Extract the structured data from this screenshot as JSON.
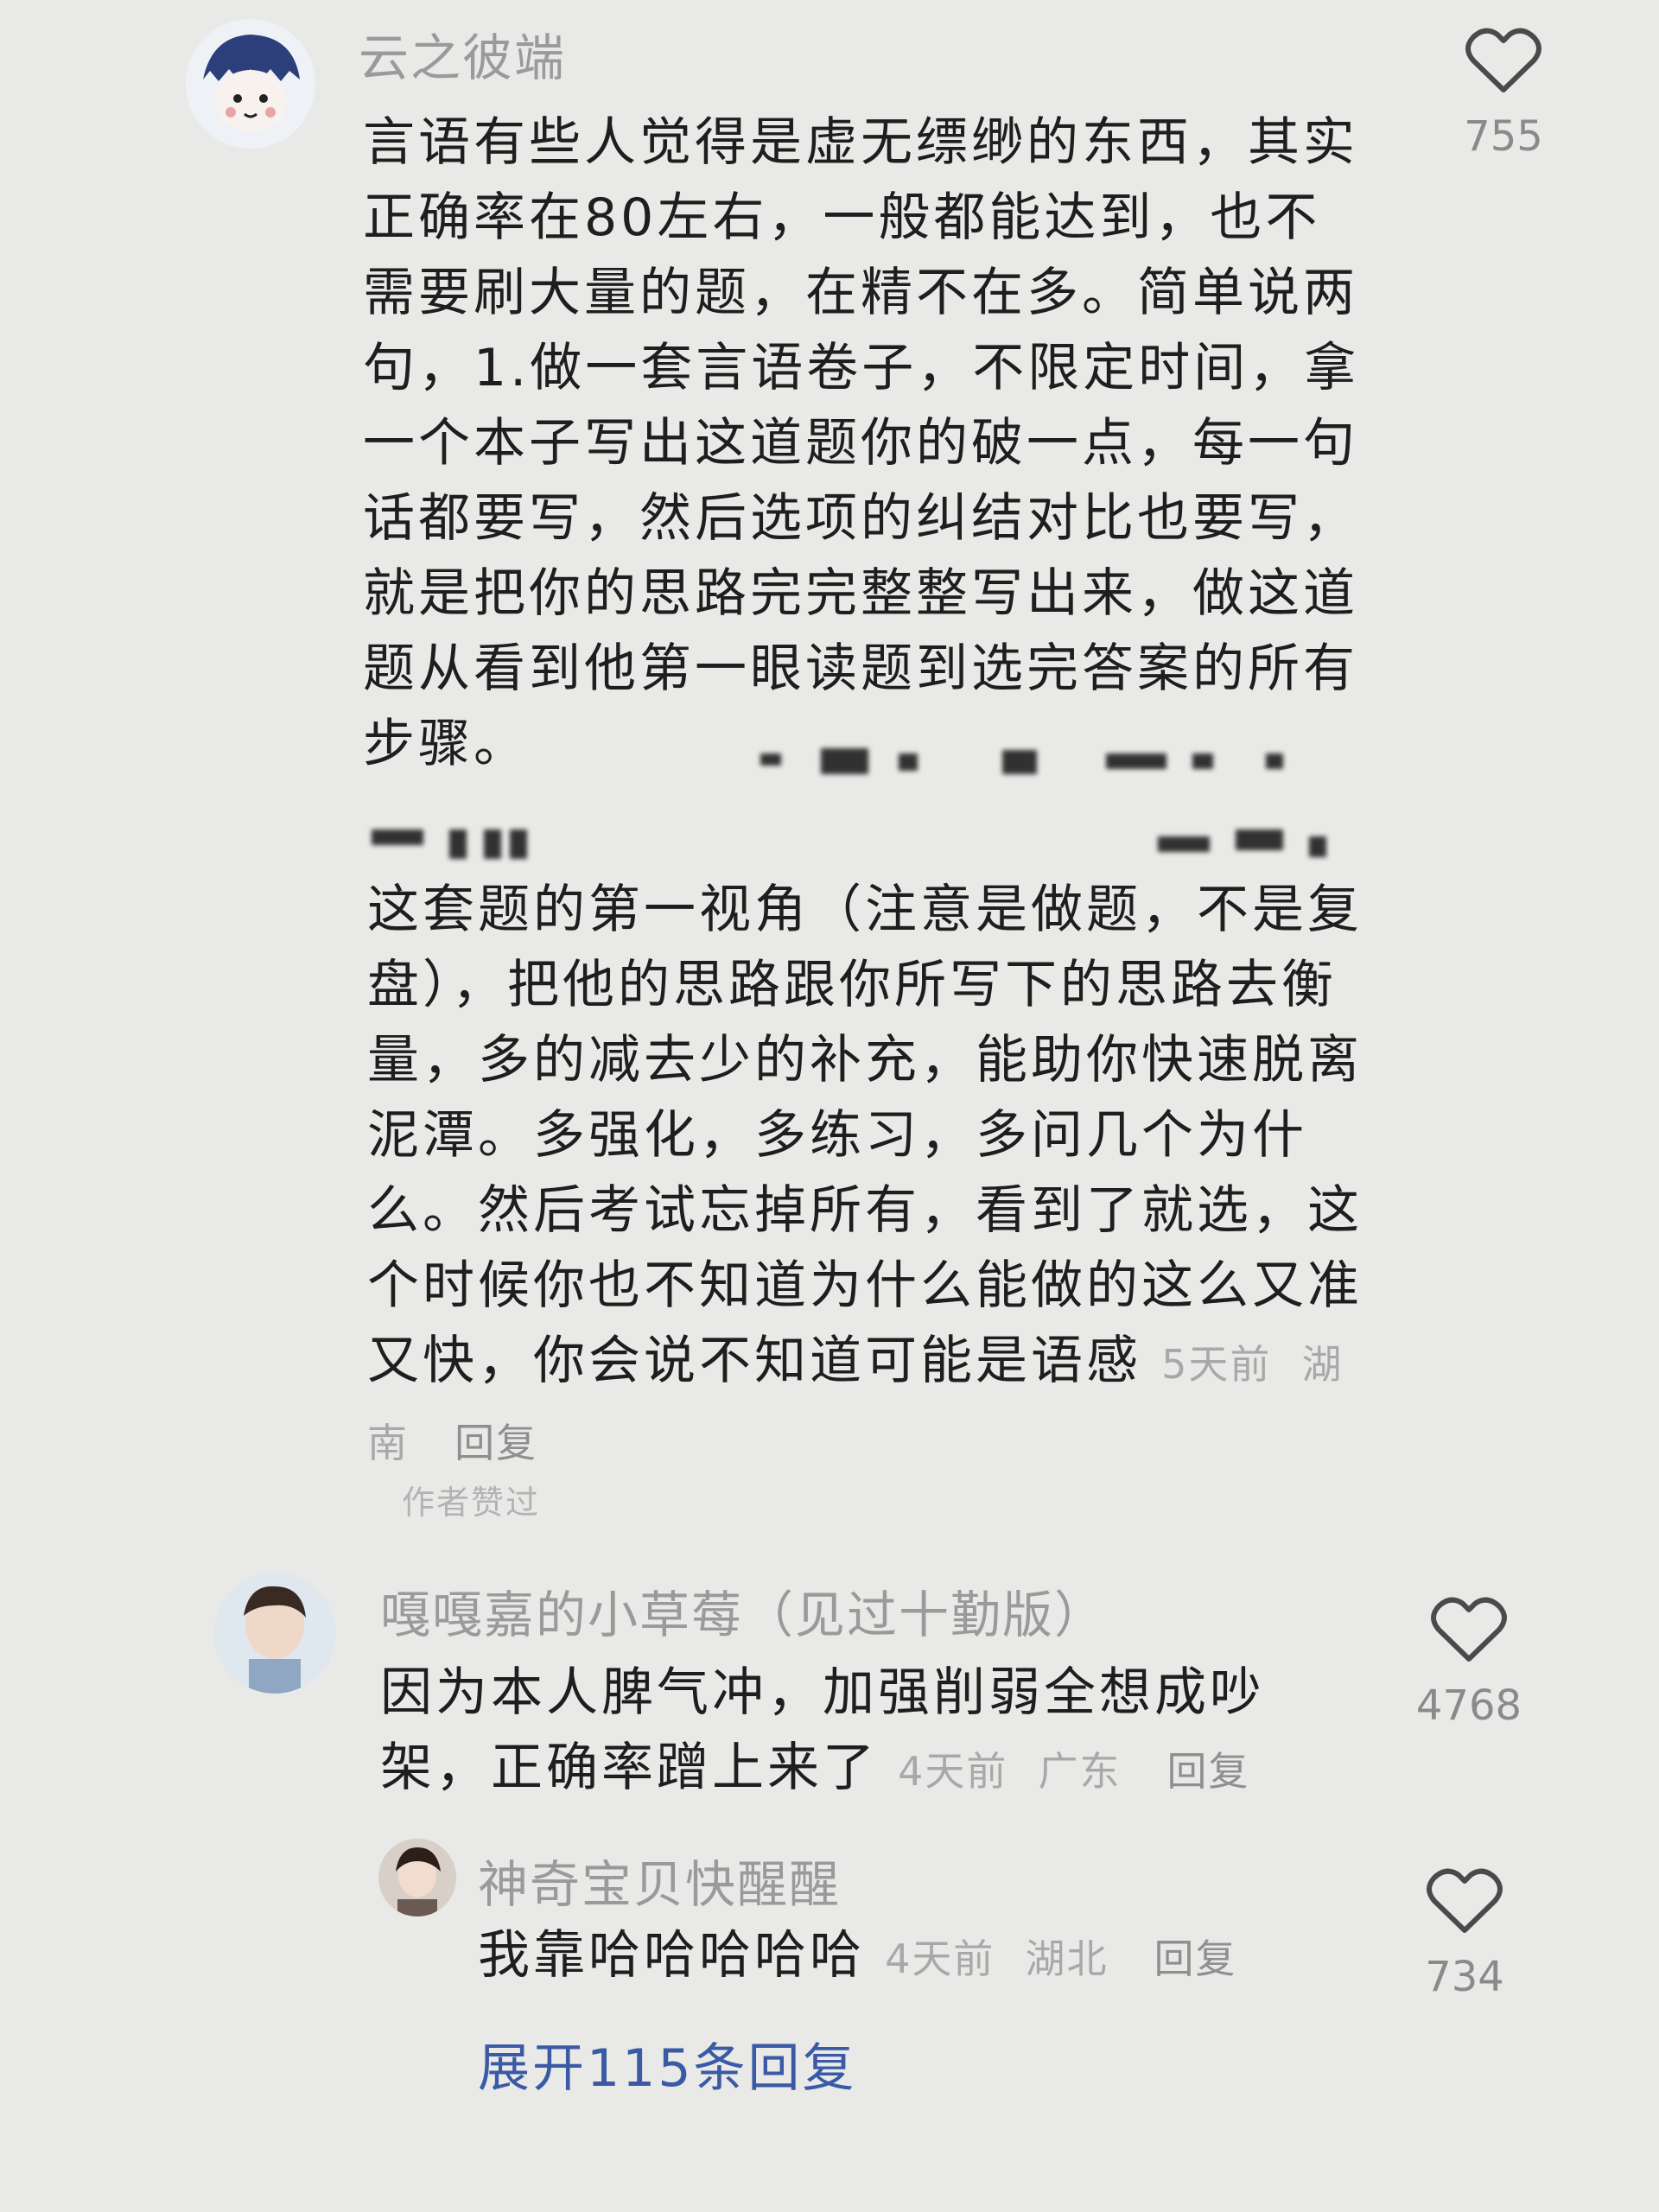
{
  "comments": [
    {
      "username": "云之彼端",
      "text_part1": "言语有些人觉得是虚无缥缈的东西，其实正确率在80左右，一般都能达到，也不需要刷大量的题，在精不在多。简单说两句，1.做一套言语卷子，不限定时间，拿一个本子写出这道题你的破一点，每一句话都要写，然后选项的纠结对比也要写，就是把你的思路完完整整写出来，做这道题从看到他第一眼读题到选完答案的所有步骤。",
      "text_part2": "这套题的第一视角（注意是做题，不是复盘），把他的思路跟你所写下的思路去衡量，多的减去少的补充，能助你快速脱离泥潭。多强化，多练习，多问几个为什么。然后考试忘掉所有，看到了就选，这个时候你也不知道为什么能做的这么又准又快，你会说不知道可能是语感",
      "time": "5天前",
      "location": "湖南",
      "reply_label": "回复",
      "author_liked": "作者赞过",
      "likes": "755"
    },
    {
      "username": "嘎嘎嘉的小草莓（见过十勤版）",
      "text": "因为本人脾气冲，加强削弱全想成吵架，正确率蹭上来了",
      "time": "4天前",
      "location": "广东",
      "reply_label": "回复",
      "likes": "4768"
    },
    {
      "username": "神奇宝贝快醒醒",
      "text": "我靠哈哈哈哈哈",
      "time": "4天前",
      "location": "湖北",
      "reply_label": "回复",
      "likes": "734"
    }
  ],
  "expand_replies": "展开115条回复",
  "colors": {
    "link_blue": "#3a5aa6",
    "meta_gray": "#a8a8a8"
  },
  "icons": {
    "like": "heart-outline-icon"
  }
}
